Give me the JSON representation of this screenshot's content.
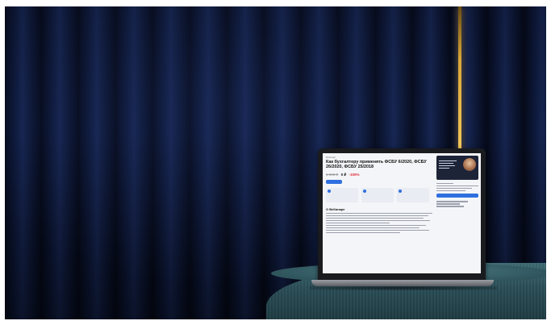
{
  "scene": {
    "description_free": true
  },
  "screen": {
    "tag": "Вебинар",
    "title": "Как бухгалтеру применять ФСБУ 6/2020, ФСБУ 26/2020, ФСБУ 25/2018",
    "old_price": "1 000 ₽",
    "new_price": "0 ₽",
    "discount": "-100%",
    "section_heading": "О Вебинаре"
  },
  "colors": {
    "curtain": "#0e1a3d",
    "gold_strip": "#d9a63a",
    "ottoman": "#2a4d56",
    "accent_blue": "#2f6fe0",
    "discount_red": "#e02a3a"
  }
}
